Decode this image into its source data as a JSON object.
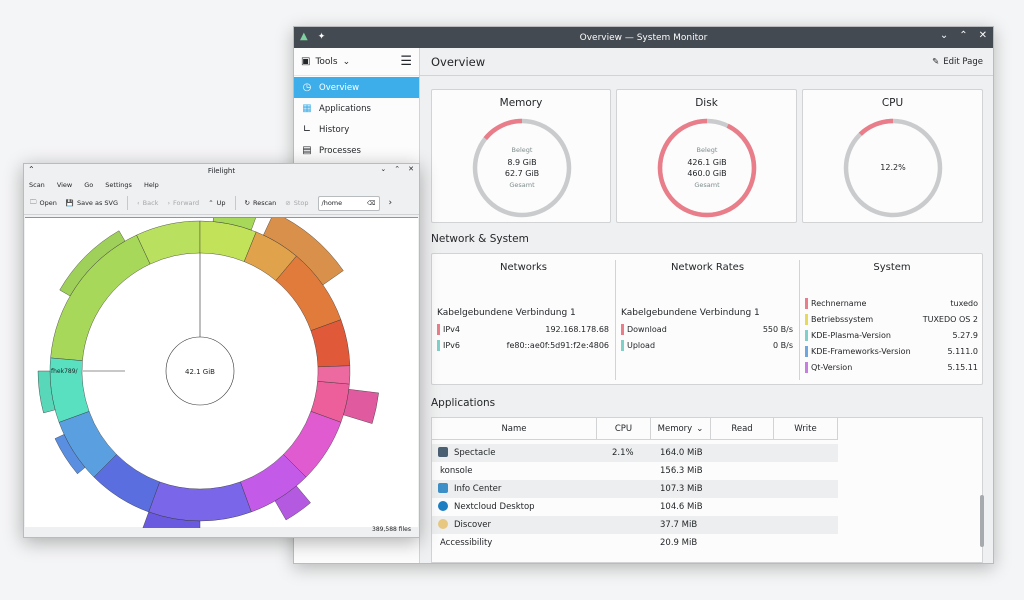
{
  "sysmon": {
    "title": "Overview — System Monitor",
    "tools_label": "Tools",
    "nav": [
      {
        "label": "Overview"
      },
      {
        "label": "Applications"
      },
      {
        "label": "History"
      },
      {
        "label": "Processes"
      }
    ],
    "page_title": "Overview",
    "edit_page": "Edit Page",
    "cards": {
      "memory": {
        "title": "Memory",
        "label_top": "Belegt",
        "used": "8.9 GiB",
        "total": "62.7 GiB",
        "label_bottom": "Gesamt",
        "fraction": 0.142,
        "color": "#e97d89"
      },
      "disk": {
        "title": "Disk",
        "label_top": "Belegt",
        "used": "426.1 GiB",
        "total": "460.0 GiB",
        "label_bottom": "Gesamt",
        "fraction": 0.926,
        "color": "#e97d89"
      },
      "cpu": {
        "title": "CPU",
        "value": "12.2%",
        "fraction": 0.122,
        "color": "#e97d89"
      }
    },
    "network_section_title": "Network & System",
    "networks": {
      "title": "Networks",
      "connection": "Kabelgebundene Verbindung 1",
      "rows": [
        {
          "key": "IPv4",
          "value": "192.168.178.68",
          "color": "#e97d89"
        },
        {
          "key": "IPv6",
          "value": "fe80::ae0f:5d91:f2e:4806",
          "color": "#7fd0c9"
        }
      ]
    },
    "rates": {
      "title": "Network Rates",
      "connection": "Kabelgebundene Verbindung 1",
      "rows": [
        {
          "key": "Download",
          "value": "550 B/s",
          "color": "#e97d89"
        },
        {
          "key": "Upload",
          "value": "0 B/s",
          "color": "#7fd0c9"
        }
      ]
    },
    "system": {
      "title": "System",
      "rows": [
        {
          "key": "Rechnername",
          "value": "tuxedo",
          "color": "#e97d89"
        },
        {
          "key": "Betriebssystem",
          "value": "TUXEDO OS 2",
          "color": "#e6d95c"
        },
        {
          "key": "KDE-Plasma-Version",
          "value": "5.27.9",
          "color": "#7fd0c9"
        },
        {
          "key": "KDE-Frameworks-Version",
          "value": "5.111.0",
          "color": "#6da6e0"
        },
        {
          "key": "Qt-Version",
          "value": "5.15.11",
          "color": "#c77ee0"
        }
      ]
    },
    "applications_title": "Applications",
    "table": {
      "headers": [
        "Name",
        "CPU",
        "Memory",
        "Read",
        "Write"
      ],
      "rows": [
        {
          "name": "Spectacle",
          "cpu": "2.1%",
          "memory": "164.0 MiB",
          "icon": "spectacle-icon"
        },
        {
          "name": "konsole",
          "cpu": "",
          "memory": "156.3 MiB",
          "icon": ""
        },
        {
          "name": "Info Center",
          "cpu": "",
          "memory": "107.3 MiB",
          "icon": "info-center-icon"
        },
        {
          "name": "Nextcloud Desktop",
          "cpu": "",
          "memory": "104.6 MiB",
          "icon": "nextcloud-icon"
        },
        {
          "name": "Discover",
          "cpu": "",
          "memory": "37.7 MiB",
          "icon": "discover-icon"
        },
        {
          "name": "Accessibility",
          "cpu": "",
          "memory": "20.9 MiB",
          "icon": ""
        }
      ]
    }
  },
  "filelight": {
    "title": "Filelight",
    "menu": [
      "Scan",
      "View",
      "Go",
      "Settings",
      "Help"
    ],
    "toolbar": {
      "open": "Open",
      "save_svg": "Save as SVG",
      "back": "Back",
      "forward": "Forward",
      "up": "Up",
      "rescan": "Rescan",
      "stop": "Stop"
    },
    "path": "/home",
    "center_label": "42.1 GiB",
    "folder_label": "fhek789/",
    "status": "389,588 files"
  }
}
